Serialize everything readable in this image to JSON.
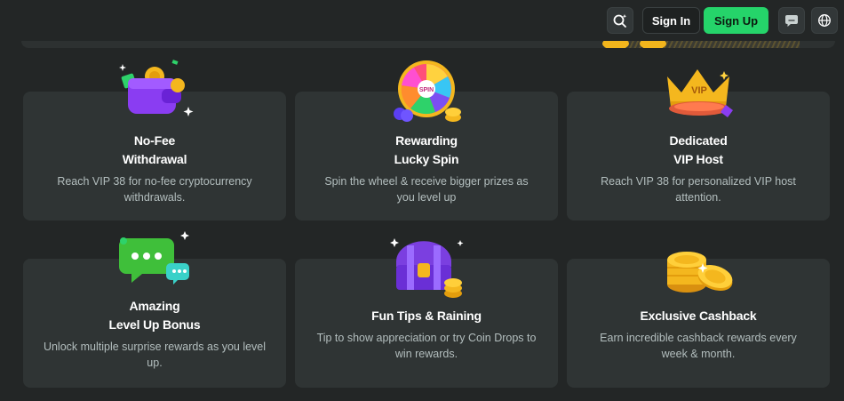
{
  "header": {
    "signin_label": "Sign In",
    "signup_label": "Sign Up",
    "icons": [
      "search-icon",
      "chat-icon",
      "globe-icon"
    ]
  },
  "colors": {
    "background": "#232626",
    "card": "#2f3434",
    "accent_green": "#25d46a",
    "text_muted": "#b3bebe"
  },
  "cards": [
    {
      "title_line1": "No-Fee",
      "title_line2": "Withdrawal",
      "desc": "Reach VIP 38 for no-fee cryptocurrency withdrawals.",
      "icon": "wallet-icon"
    },
    {
      "title_line1": "Rewarding",
      "title_line2": "Lucky Spin",
      "desc": "Spin the wheel & receive bigger prizes as you level up",
      "icon": "spin-wheel-icon"
    },
    {
      "title_line1": "Dedicated",
      "title_line2": "VIP Host",
      "desc": "Reach VIP 38 for personalized VIP host attention.",
      "icon": "crown-icon"
    },
    {
      "title_line1": "Amazing",
      "title_line2": "Level Up Bonus",
      "desc": "Unlock multiple surprise rewards as you level up.",
      "icon": "chat-bubble-icon"
    },
    {
      "title_line1": "Fun Tips & Raining",
      "desc": "Tip to show appreciation or try Coin Drops to win rewards.",
      "icon": "treasure-chest-icon"
    },
    {
      "title_line1": "Exclusive Cashback",
      "desc": "Earn incredible cashback rewards every week & month.",
      "icon": "coin-stack-icon"
    }
  ]
}
